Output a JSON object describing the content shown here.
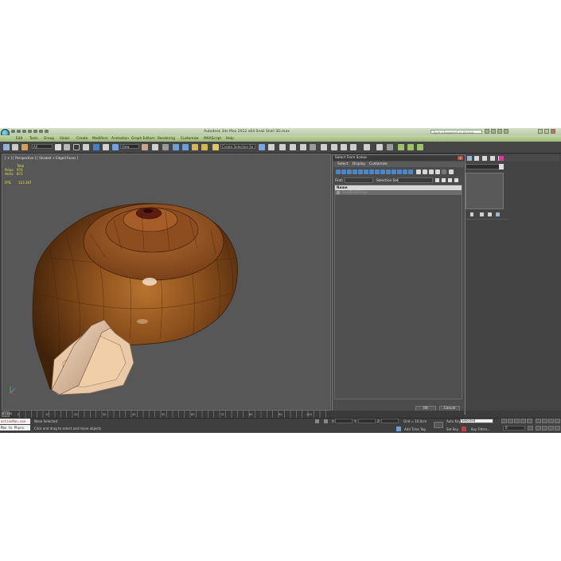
{
  "app": {
    "title": "Autodesk 3ds Max 2012 x64     Snail Shell 3D.max",
    "search_placeholder": "Type a keyword or phrase"
  },
  "menu": [
    "Edit",
    "Tools",
    "Group",
    "Views",
    "Create",
    "Modifiers",
    "Animation",
    "Graph Editors",
    "Rendering",
    "Customize",
    "MAXScript",
    "Help"
  ],
  "toolbar": {
    "selection_filter": "All",
    "reference_coord": "View",
    "named_selection": "Create Selection Se"
  },
  "viewport": {
    "label": "[ + ] [ Perspective ] [ Shaded + Edged Faces ]",
    "stats": {
      "total_label": "Total",
      "polys_label": "Polys:",
      "polys_value": "976",
      "verts_label": "Verts:",
      "verts_value": "871",
      "fps_label": "FPS:",
      "fps_value": "123.367"
    }
  },
  "dialog": {
    "title": "Select From Scene",
    "close_glyph": "x",
    "menu": [
      "Select",
      "Display",
      "Customize"
    ],
    "find_label": "Find:",
    "selection_set_label": "Selection Set:",
    "column_name": "Name",
    "rows": [
      "SnailShellGroup"
    ],
    "ok_label": "OK",
    "cancel_label": "Cancel"
  },
  "timeline": {
    "frame_counter": "0 / 100",
    "ticks": [
      "0",
      "10",
      "20",
      "30",
      "40",
      "50",
      "60",
      "70",
      "80",
      "90",
      "100"
    ]
  },
  "status": {
    "maxscript_line1": "actionMan.exe",
    "maxscript_line2": "Max to Physx",
    "selection_text": "None Selected",
    "prompt_text": "Click and drag to select and move objects",
    "grid_text": "Grid = 10,0cm",
    "add_time_tag": "Add Time Tag",
    "autokey_label": "Auto Key",
    "autokey_value": "Selected",
    "setkey_label": "Set Key",
    "key_filters": "Key Filters...",
    "frame_value": "0"
  },
  "colors": {
    "titlebar": "#c3d5a6",
    "viewport_bg": "#575757",
    "stats_text": "#e3e340",
    "selection_highlight": "#4b86c7"
  }
}
